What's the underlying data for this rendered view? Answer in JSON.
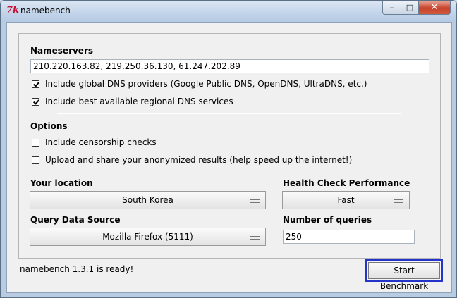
{
  "window": {
    "title": "namebench",
    "icon_glyph": "7k",
    "controls": {
      "minimize": "–",
      "maximize": "□",
      "close": "✕"
    }
  },
  "nameservers": {
    "heading": "Nameservers",
    "value": "210.220.163.82, 219.250.36.130, 61.247.202.89",
    "include_global": {
      "label": "Include global DNS providers (Google Public DNS, OpenDNS, UltraDNS, etc.)",
      "checked": true
    },
    "include_regional": {
      "label": "Include best available regional DNS services",
      "checked": true
    }
  },
  "options": {
    "heading": "Options",
    "censorship": {
      "label": "Include censorship checks",
      "checked": false
    },
    "upload": {
      "label": "Upload and share your anonymized results (help speed up the internet!)",
      "checked": false
    }
  },
  "location": {
    "label": "Your location",
    "value": "South Korea"
  },
  "health": {
    "label": "Health Check Performance",
    "value": "Fast"
  },
  "query_source": {
    "label": "Query Data Source",
    "value": "Mozilla Firefox (5111)"
  },
  "num_queries": {
    "label": "Number of queries",
    "value": "250"
  },
  "status": {
    "text": "namebench 1.3.1 is ready!"
  },
  "start_button": {
    "label": "Start Benchmark"
  }
}
